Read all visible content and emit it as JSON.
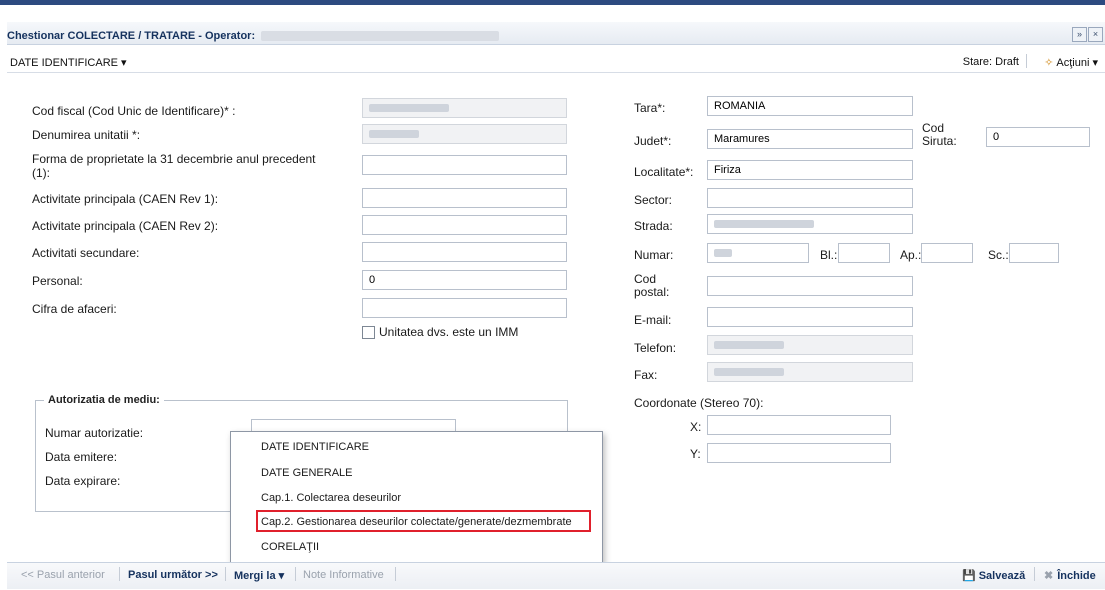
{
  "window": {
    "title": "Chestionar COLECTARE / TRATARE - Operator:",
    "collapse_glyph": "»",
    "close_glyph": "×"
  },
  "toolbar": {
    "section_dropdown": "DATE IDENTIFICARE ▾",
    "status": "Stare: Draft",
    "actions": "Acţiuni ▾",
    "actions_icon": "✧"
  },
  "left_form": {
    "cod_fiscal_label": "Cod fiscal (Cod Unic de Identificare)* :",
    "denumire_label": "Denumirea unitatii *:",
    "forma_label": "Forma de proprietate la 31 decembrie anul precedent",
    "forma_label_2": "(1):",
    "caen1_label": "Activitate principala (CAEN Rev 1):",
    "caen2_label": "Activitate principala (CAEN Rev 2):",
    "secundare_label": "Activitati secundare:",
    "personal_label": "Personal:",
    "personal_value": "0",
    "cifra_label": "Cifra de afaceri:",
    "imm_label": "Unitatea dvs. este un IMM"
  },
  "autorizatie": {
    "legend": "Autorizatia de mediu:",
    "numar_label": "Numar autorizatie:",
    "emitere_label": "Data emitere:",
    "expirare_label": "Data expirare:"
  },
  "right_form": {
    "tara_label": "Tara*:",
    "tara_value": "ROMANIA",
    "judet_label": "Judet*:",
    "judet_value": "Maramures",
    "cod_siruta_label_1": "Cod",
    "cod_siruta_label_2": "Siruta:",
    "cod_siruta_value": "0",
    "localitate_label": "Localitate*:",
    "localitate_value": "Firiza",
    "sector_label": "Sector:",
    "strada_label": "Strada:",
    "numar_label": "Numar:",
    "bl_label": "Bl.:",
    "ap_label": "Ap.:",
    "sc_label": "Sc.:",
    "cod_postal_label_1": "Cod",
    "cod_postal_label_2": "postal:",
    "email_label": "E-mail:",
    "telefon_label": "Telefon:",
    "fax_label": "Fax:",
    "coordonate_label": "Coordonate (Stereo 70):",
    "x_label": "X:",
    "y_label": "Y:"
  },
  "dropdown_menu": {
    "items": [
      "DATE IDENTIFICARE",
      "DATE GENERALE",
      "Cap.1. Colectarea deseurilor",
      "Cap.2. Gestionarea deseurilor colectate/generate/dezmembrate",
      "CORELAŢII"
    ]
  },
  "footer": {
    "prev": "<< Pasul anterior",
    "next": "Pasul următor >>",
    "goto": "Mergi la ▾",
    "notes": "Note Informative",
    "save": "Salvează",
    "save_icon": "💾",
    "close": "Închide",
    "close_icon": "✖"
  }
}
